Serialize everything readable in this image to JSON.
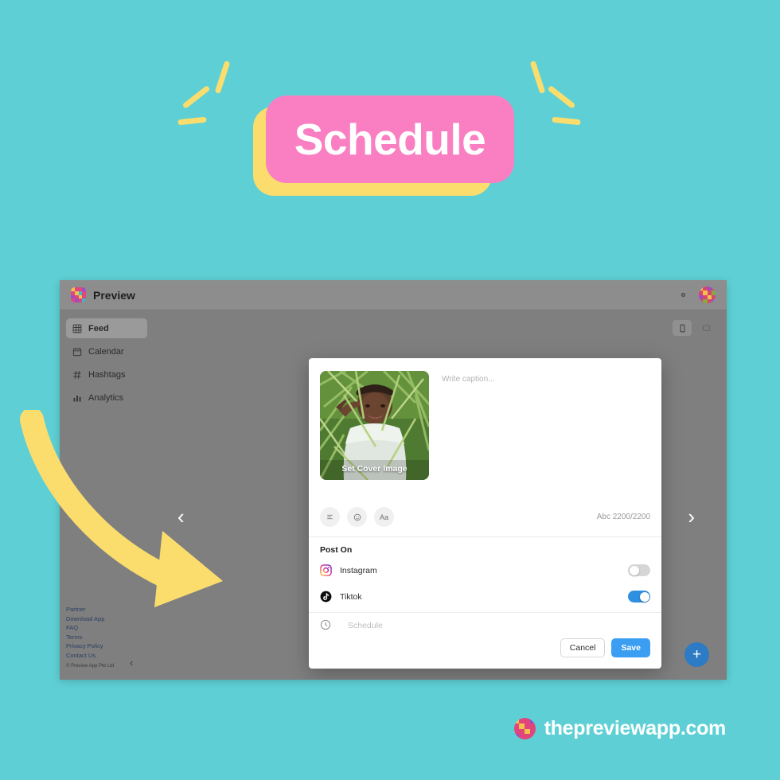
{
  "theme": {
    "background": "#5ed0d5",
    "banner_pink": "#f97fc2",
    "banner_yellow": "#fbdd6e",
    "accent_blue": "#3b9ef2",
    "toggle_on": "#2f8fe0"
  },
  "hero": {
    "title": "Schedule"
  },
  "app": {
    "brand": "Preview",
    "logo_icon": "preview-grid-logo",
    "settings_icon": "gear-icon",
    "avatar_icon": "user-avatar",
    "sidebar": {
      "items": [
        {
          "label": "Feed",
          "icon": "grid-icon",
          "active": true
        },
        {
          "label": "Calendar",
          "icon": "calendar-icon",
          "active": false
        },
        {
          "label": "Hashtags",
          "icon": "hash-icon",
          "active": false
        },
        {
          "label": "Analytics",
          "icon": "bar-chart-icon",
          "active": false
        }
      ],
      "footer_links": [
        "Partner",
        "Download App",
        "FAQ",
        "Terms",
        "Privacy Policy",
        "Contact Us"
      ],
      "copyright": "© Preview App Pte Ltd",
      "collapse_icon": "chevron-left-icon"
    },
    "view_toggle": [
      {
        "icon": "mobile-preview-icon",
        "active": true
      },
      {
        "icon": "desktop-preview-icon",
        "active": false
      }
    ],
    "prev_arrow": "‹",
    "next_arrow": "›",
    "add_button_label": "+"
  },
  "modal": {
    "thumbnail": {
      "cover_label": "Set Cover Image",
      "alt": "person lying in green grass wearing a white t-shirt"
    },
    "caption_placeholder": "Write caption...",
    "tools": [
      {
        "icon": "text-align-icon",
        "label": ""
      },
      {
        "icon": "emoji-icon",
        "label": ""
      },
      {
        "icon": "font-size-icon",
        "label": "Aa"
      }
    ],
    "char_count": "Abc 2200/2200",
    "post_on_title": "Post On",
    "accounts": [
      {
        "name": "Instagram",
        "icon": "instagram-icon",
        "enabled": false
      },
      {
        "name": "Tiktok",
        "icon": "tiktok-icon",
        "enabled": true
      }
    ],
    "schedule": {
      "icon": "clock-icon",
      "label": "Schedule"
    },
    "cancel_label": "Cancel",
    "save_label": "Save"
  },
  "watermark": {
    "text": "thepreviewapp.com",
    "logo_icon": "preview-circle-logo"
  }
}
